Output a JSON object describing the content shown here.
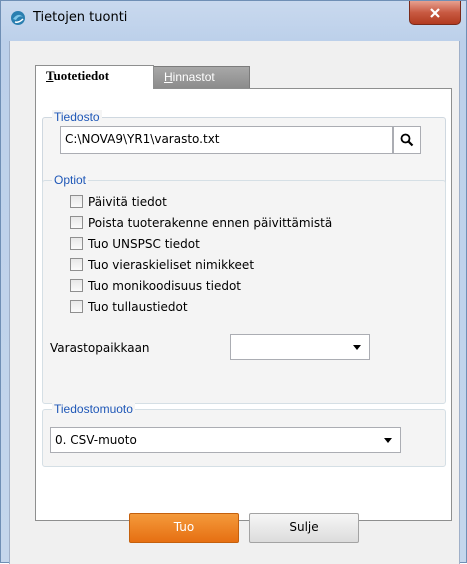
{
  "window": {
    "title": "Tietojen tuonti",
    "close_label": "x"
  },
  "tabs": [
    {
      "label_u": "T",
      "label_rest": "uotetiedot",
      "active": true
    },
    {
      "label_u": "H",
      "label_rest": "innastot",
      "active": false
    }
  ],
  "file_group": {
    "legend": "Tiedosto",
    "path_value": "C:\\NOVA9\\YR1\\varasto.txt"
  },
  "options_group": {
    "legend": "Optiot",
    "checkboxes": [
      {
        "label": "Päivitä tiedot",
        "checked": false
      },
      {
        "label": "Poista tuoterakenne ennen päivittämistä",
        "checked": false
      },
      {
        "label": "Tuo UNSPSC tiedot",
        "checked": false
      },
      {
        "label": "Tuo vieraskieliset nimikkeet",
        "checked": false
      },
      {
        "label": "Tuo monikoodisuus tiedot",
        "checked": false
      },
      {
        "label": "Tuo tullaustiedot",
        "checked": false
      }
    ],
    "warehouse_label": "Varastopaikkaan",
    "warehouse_value": ""
  },
  "format_group": {
    "legend": "Tiedostomuoto",
    "selected": "0. CSV-muoto"
  },
  "buttons": {
    "import": "Tuo",
    "close": "Sulje"
  },
  "colors": {
    "accent_legend": "#1e57b7",
    "primary_button": "#e66f12",
    "close_button": "#c85a42"
  }
}
